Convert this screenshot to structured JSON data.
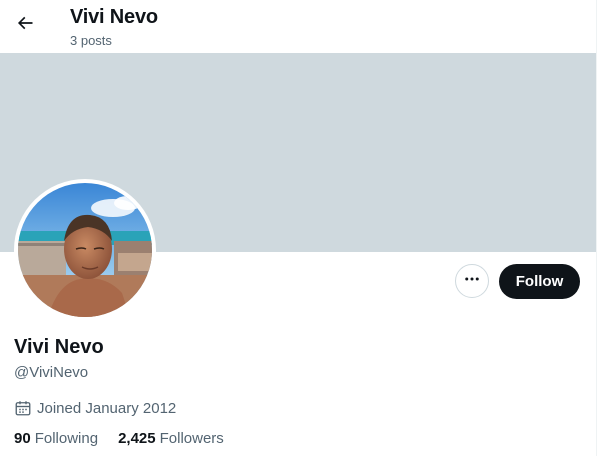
{
  "header": {
    "title": "Vivi Nevo",
    "post_count": "3 posts",
    "back_icon": "arrow-left-icon"
  },
  "banner": {
    "color": "#cfd9de"
  },
  "profile": {
    "display_name": "Vivi Nevo",
    "handle": "@ViviNevo",
    "joined": "Joined January 2012",
    "joined_icon": "calendar-icon",
    "following_count": "90",
    "following_label": "Following",
    "followers_count": "2,425",
    "followers_label": "Followers"
  },
  "actions": {
    "more_icon": "more-horizontal-icon",
    "follow_label": "Follow"
  },
  "colors": {
    "text_primary": "#0f1419",
    "text_secondary": "#536471",
    "follow_bg": "#0f1419",
    "border": "#cfd9de"
  }
}
